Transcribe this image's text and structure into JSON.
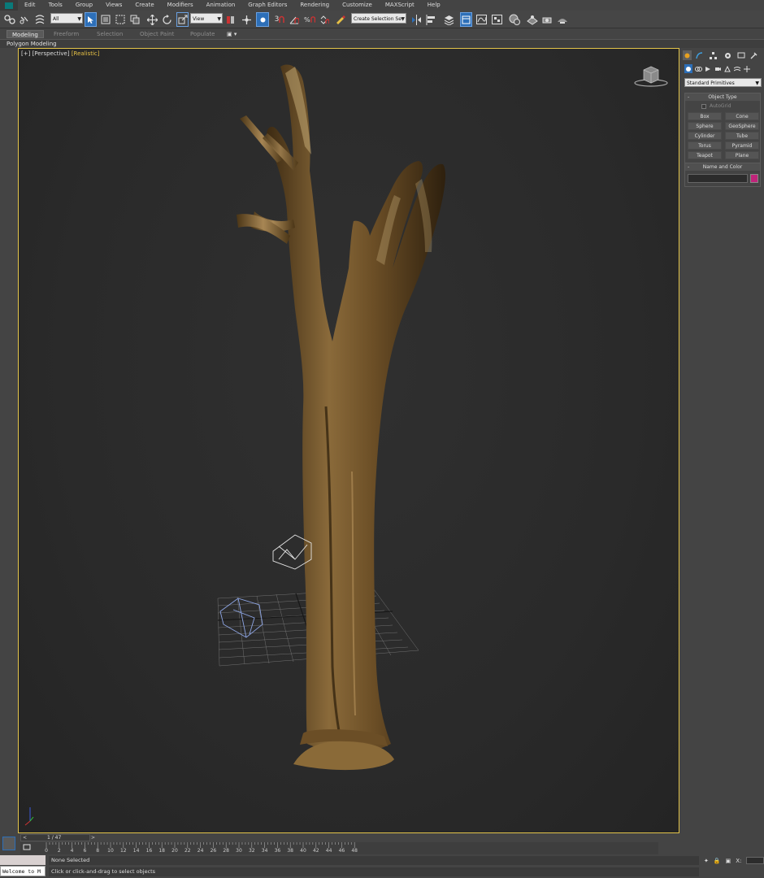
{
  "menu": [
    "Edit",
    "Tools",
    "Group",
    "Views",
    "Create",
    "Modifiers",
    "Animation",
    "Graph Editors",
    "Rendering",
    "Customize",
    "MAXScript",
    "Help"
  ],
  "toolbar": {
    "filter_value": "All",
    "refcoord_value": "View",
    "selection_set_placeholder": "Create Selection Se",
    "snap_labels": {
      "snap": "3",
      "angle": "",
      "percent": "%"
    }
  },
  "ribbon": {
    "tabs": [
      "Modeling",
      "Freeform",
      "Selection",
      "Object Paint",
      "Populate"
    ],
    "active": "Modeling",
    "sub_label": "Polygon Modeling"
  },
  "viewport": {
    "label_plus": "[+]",
    "label_view": "[Perspective]",
    "label_mode": "[Realistic]"
  },
  "command_panel": {
    "primitives_dropdown": "Standard Primitives",
    "object_type_header": "Object Type",
    "autogrid_label": "AutoGrid",
    "buttons": [
      "Box",
      "Cone",
      "Sphere",
      "GeoSphere",
      "Cylinder",
      "Tube",
      "Torus",
      "Pyramid",
      "Teapot",
      "Plane"
    ],
    "name_color_header": "Name and Color",
    "object_color": "#c0247a"
  },
  "timeline": {
    "frame_counter": "1 / 47",
    "prev": "<",
    "next": ">",
    "ticks": [
      "0",
      "2",
      "4",
      "6",
      "8",
      "10",
      "12",
      "14",
      "16",
      "18",
      "20",
      "22",
      "24",
      "26",
      "28",
      "30",
      "32",
      "34",
      "36",
      "38",
      "40",
      "42",
      "44",
      "46",
      "48"
    ]
  },
  "status": {
    "maxscript": "Welcome to M",
    "selection": "None Selected",
    "prompt": "Click or click-and-drag to select objects",
    "x_label": "X:"
  },
  "colors": {
    "viewport_border": "#e3c44a",
    "mode_label": "#e6c045",
    "accent_blue": "#2d6fb8"
  }
}
